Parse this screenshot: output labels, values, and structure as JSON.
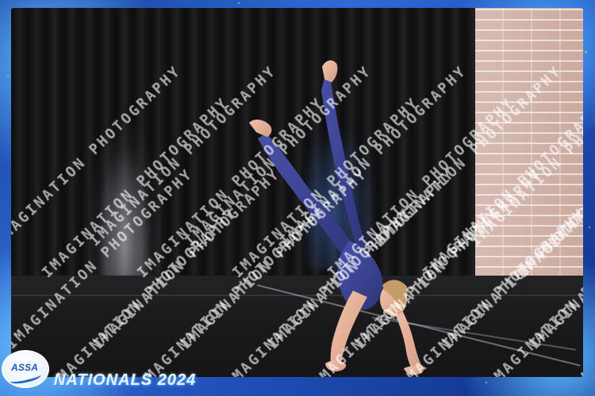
{
  "event": {
    "logo_text": "ASSA",
    "title": "NATIONALS 2024"
  },
  "watermark": {
    "text": "IMAGINATION PHOTOGRAPHY"
  },
  "colors": {
    "frame_blue": "#1f4db4",
    "gold_accent": "#d8b24a",
    "costume_navy": "#3e4597"
  }
}
